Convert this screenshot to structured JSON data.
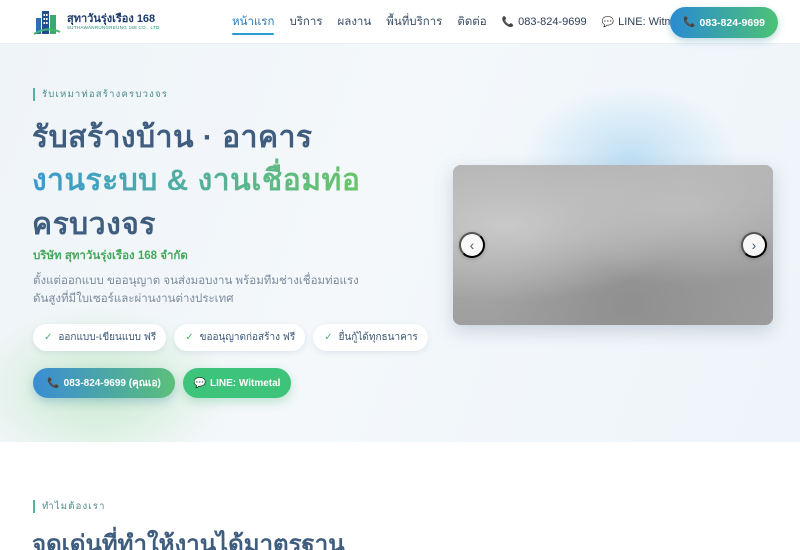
{
  "brand": {
    "name": "สุทาวันรุ่งเรือง 168",
    "subtitle": "SUTHAWANRUNGREUNG 168 CO., LTD"
  },
  "nav": {
    "items": [
      "หน้าแรก",
      "บริการ",
      "ผลงาน",
      "พื้นที่บริการ",
      "ติดต่อ"
    ],
    "active": "หน้าแรก",
    "phone": "083-824-9699",
    "line": "LINE: Witmetal",
    "cta": "083-824-9699"
  },
  "hero": {
    "eyebrow": "รับเหมาท่อสร้างครบวงจร",
    "headline1": "รับสร้างบ้าน · อาคาร",
    "headline2": "งานระบบ & งานเชื่อมท่อ",
    "headline3": "ครบวงจร",
    "company": "บริษัท สุทาวันรุ่งเรือง 168 จำกัด",
    "description": "ตั้งแต่ออกแบบ ขออนุญาต จนส่งมอบงาน พร้อมทีมช่างเชื่อมท่อแรงดันสูงที่มีใบเซอร์และผ่านงานต่างประเทศ",
    "chips": [
      "ออกแบบ-เขียนแบบ ฟรี",
      "ขออนุญาตก่อสร้าง ฟรี",
      "ยื่นกู้ได้ทุกธนาคาร"
    ],
    "cta_phone": "083-824-9699 (คุณเอ)",
    "cta_line": "LINE: Witmetal"
  },
  "slider": {
    "prev": "‹",
    "next": "›"
  },
  "section": {
    "eyebrow": "ทำไมต้องเรา",
    "title": "จุดเด่นที่ทำให้งานได้มาตรฐาน"
  },
  "icons": {
    "phone": "phone-icon",
    "chat": "chat-icon",
    "check": "check-icon"
  },
  "colors": {
    "accent_blue": "#2a8bd2",
    "accent_green": "#4cc276",
    "heading": "#3f5d7e"
  }
}
